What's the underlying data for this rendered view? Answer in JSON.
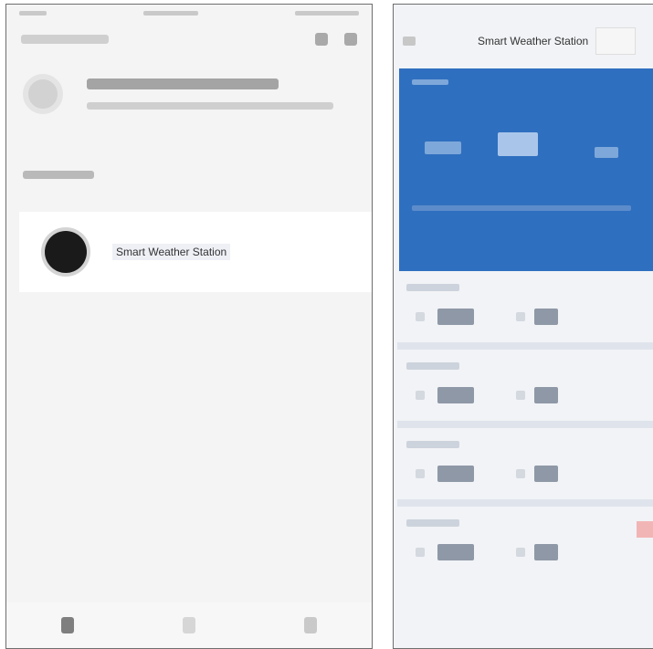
{
  "left_screen": {
    "device": {
      "name": "Smart Weather Station"
    }
  },
  "right_screen": {
    "header": {
      "title": "Smart Weather Station"
    }
  },
  "colors": {
    "weather_card": "#2f6fbf",
    "device_icon": "#1a1a1a"
  },
  "icons": {
    "device": "device-icon",
    "back": "back-arrow-icon"
  }
}
